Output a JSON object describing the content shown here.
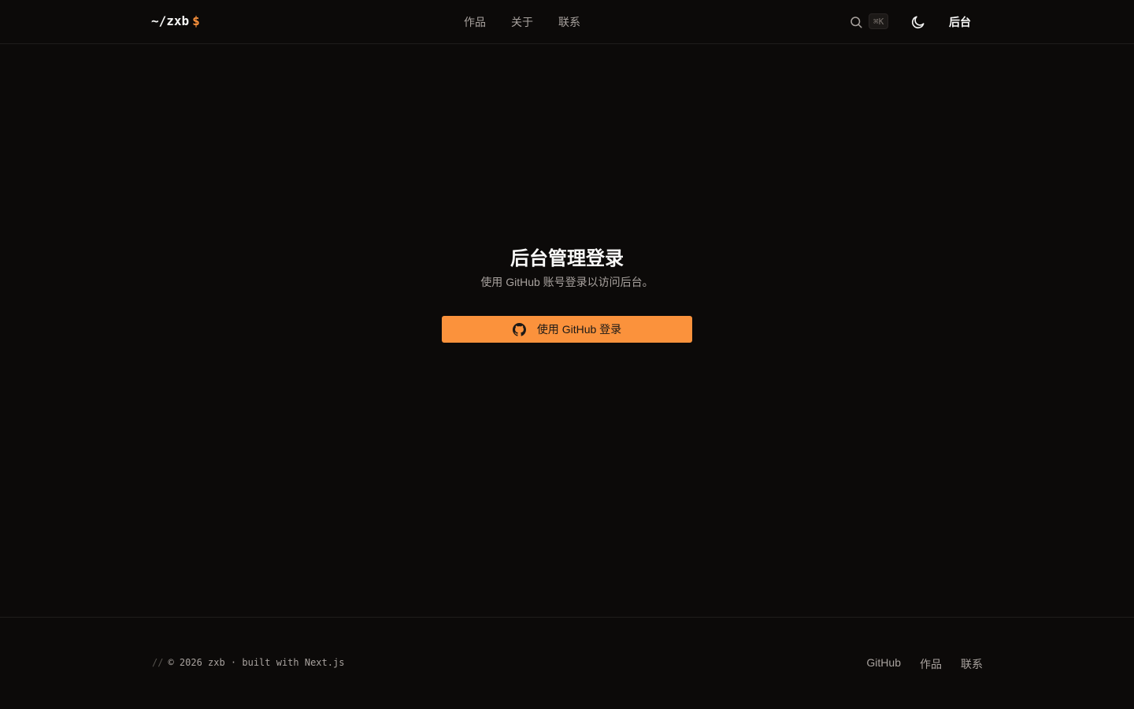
{
  "header": {
    "logo_text": "~/zxb",
    "logo_prompt": "$",
    "nav": [
      "作品",
      "关于",
      "联系"
    ],
    "search_shortcut": "⌘K",
    "admin_label": "后台"
  },
  "login": {
    "title": "后台管理登录",
    "description": "使用 GitHub 账号登录以访问后台。",
    "button_label": "使用 GitHub 登录"
  },
  "footer": {
    "copyright_prefix": "//",
    "copyright": "© 2026 zxb · built with Next.js",
    "links": [
      "GitHub",
      "作品",
      "联系"
    ]
  },
  "colors": {
    "background": "#0c0a09",
    "accent": "#fb923c"
  },
  "icons": [
    "search-icon",
    "moon-icon",
    "github-icon"
  ]
}
